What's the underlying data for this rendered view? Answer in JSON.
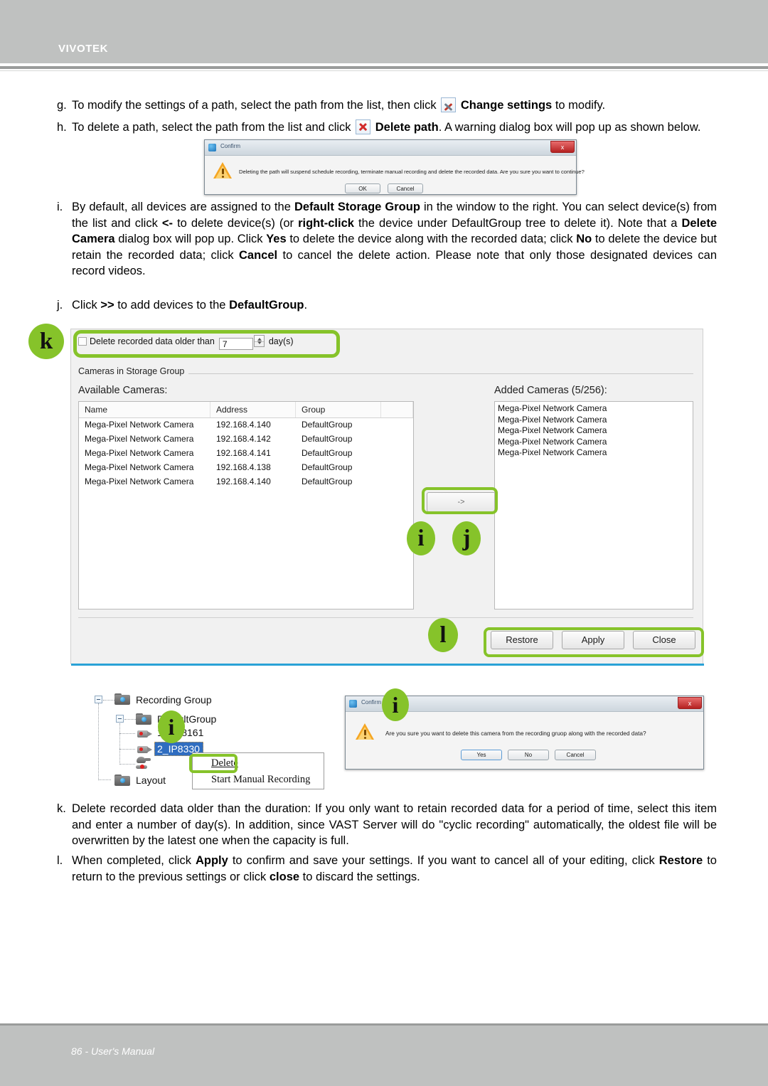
{
  "header": {
    "brand": "VIVOTEK"
  },
  "footer": {
    "page_label": "86 - User's Manual"
  },
  "steps": {
    "g": {
      "marker": "g.",
      "part1": "To modify the settings of a path, select the path from the list, then click",
      "icon": "tools-icon",
      "bold1": "Change settings",
      "part2": "to modify."
    },
    "h": {
      "marker": "h.",
      "part1": "To delete a path, select the path from the list and click",
      "icon": "delete-icon",
      "bold1": "Delete path",
      "part2": ". A warning dialog box will pop up  as shown below."
    },
    "i": {
      "marker": "i.",
      "text_runs": [
        {
          "t": "By default, all devices are assigned to the ",
          "b": false
        },
        {
          "t": "Default Storage Group",
          "b": true
        },
        {
          "t": " in the window to the right. You can select device(s) from the list and click ",
          "b": false
        },
        {
          "t": "<-",
          "b": true
        },
        {
          "t": " to delete device(s) (or ",
          "b": false
        },
        {
          "t": "right-click",
          "b": true
        },
        {
          "t": " the device under DefaultGroup tree to delete it). Note that a ",
          "b": false
        },
        {
          "t": "Delete Camera",
          "b": true
        },
        {
          "t": " dialog box will pop up. Click ",
          "b": false
        },
        {
          "t": "Yes",
          "b": true
        },
        {
          "t": " to delete the device along with the recorded data; click ",
          "b": false
        },
        {
          "t": "No",
          "b": true
        },
        {
          "t": " to delete the device but retain the recorded data; click ",
          "b": false
        },
        {
          "t": "Cancel",
          "b": true
        },
        {
          "t": " to cancel the delete action. Please note that only those designated devices can record videos.",
          "b": false
        }
      ]
    },
    "j": {
      "marker": "j.",
      "text_runs": [
        {
          "t": "Click ",
          "b": false
        },
        {
          "t": ">>",
          "b": true
        },
        {
          "t": " to add devices to the ",
          "b": false
        },
        {
          "t": "DefaultGroup",
          "b": true
        },
        {
          "t": ".",
          "b": false
        }
      ]
    },
    "k": {
      "marker": "k.",
      "text_runs": [
        {
          "t": "Delete recorded data older than the duration: If you only want to retain recorded data for a period of time, select this item and enter a number of day(s). In addition, since VAST Server will do \"cyclic recording\" automatically, the oldest file will be overwritten by the latest one when the capacity is full.",
          "b": false
        }
      ]
    },
    "l": {
      "marker": "l.",
      "text_runs": [
        {
          "t": "When completed, click ",
          "b": false
        },
        {
          "t": "Apply",
          "b": true
        },
        {
          "t": " to confirm and save your settings. If you want to cancel all of your editing, click ",
          "b": false
        },
        {
          "t": "Restore",
          "b": true
        },
        {
          "t": " to return to the previous settings or click ",
          "b": false
        },
        {
          "t": "close",
          "b": true
        },
        {
          "t": " to discard the settings.",
          "b": false
        }
      ]
    }
  },
  "warn_dialog": {
    "title": "Confirm",
    "message": "Deleting the path will suspend schedule recording, terminate manual recording and delete the recorded data. Are you sure you want to continue?",
    "ok_label": "OK",
    "cancel_label": "Cancel",
    "close_label": "x"
  },
  "delete_camera_dialog": {
    "title": "Confirm",
    "message": "Are you sure you want to delete this camera from the recording gruop along with the recorded data?",
    "yes_label": "Yes",
    "no_label": "No",
    "cancel_label": "Cancel",
    "close_label": "x"
  },
  "vast_panel": {
    "delete_older": {
      "checkbox_checked": false,
      "label": "Delete recorded data older than",
      "value": "7",
      "unit": "day(s)"
    },
    "group_label": "Cameras in Storage Group",
    "available": {
      "title": "Available Cameras:",
      "columns": [
        "Name",
        "Address",
        "Group"
      ],
      "rows": [
        {
          "name": "Mega-Pixel Network Camera",
          "address": "192.168.4.140",
          "group": "DefaultGroup"
        },
        {
          "name": "Mega-Pixel Network Camera",
          "address": "192.168.4.142",
          "group": "DefaultGroup"
        },
        {
          "name": "Mega-Pixel Network Camera",
          "address": "192.168.4.141",
          "group": "DefaultGroup"
        },
        {
          "name": "Mega-Pixel Network Camera",
          "address": "192.168.4.138",
          "group": "DefaultGroup"
        },
        {
          "name": "Mega-Pixel Network Camera",
          "address": "192.168.4.140",
          "group": "DefaultGroup"
        }
      ]
    },
    "added": {
      "title": "Added Cameras (5/256):",
      "rows": [
        "Mega-Pixel Network Camera",
        "Mega-Pixel Network Camera",
        "Mega-Pixel Network Camera",
        "Mega-Pixel Network Camera",
        "Mega-Pixel Network Camera"
      ]
    },
    "move_button": "->",
    "buttons": {
      "restore": "Restore",
      "apply": "Apply",
      "close": "Close"
    }
  },
  "tree": {
    "root": "Recording Group",
    "child": "DefaultGroup",
    "items": [
      "1_FD8161",
      "2_IP8330"
    ],
    "selected": "2_IP8330",
    "layout": "Layout",
    "context_menu": [
      "Delete",
      "Start Manual Recording"
    ]
  },
  "badges": {
    "k": "k",
    "i": "i",
    "j": "j",
    "l": "l",
    "i2": "i",
    "i3": "i"
  },
  "colors": {
    "accent_green": "#86c32a",
    "header_gray": "#bfc1c0",
    "panel_blue": "#2aa2d6"
  }
}
